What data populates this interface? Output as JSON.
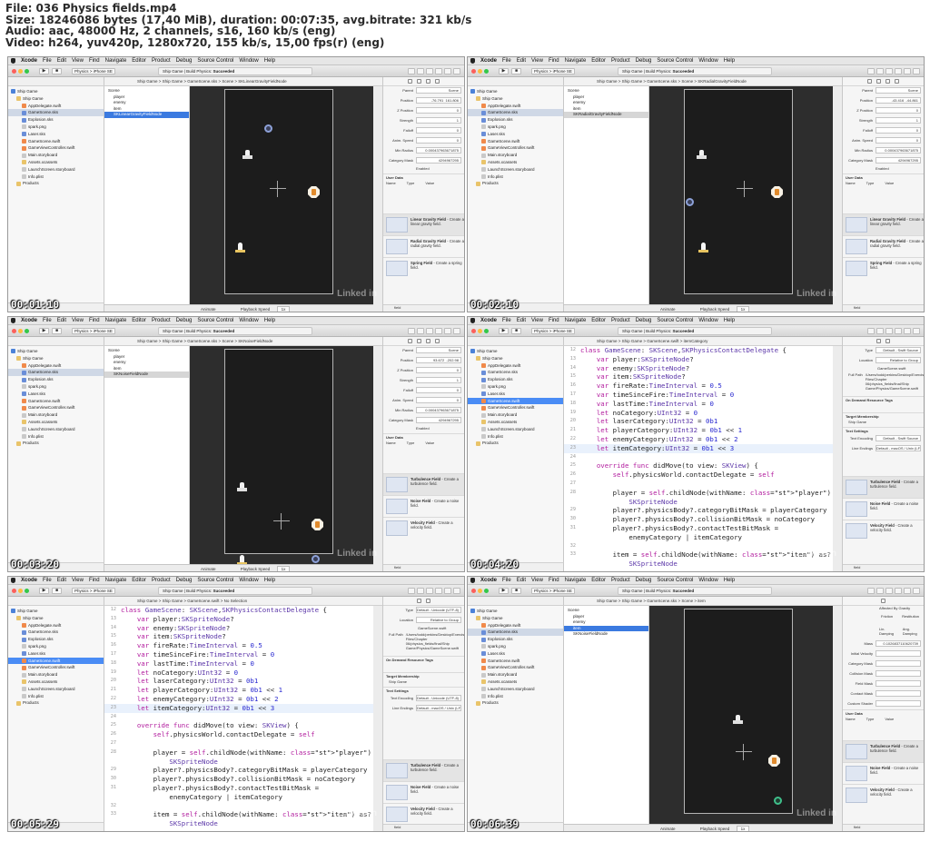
{
  "header": {
    "line1": "File: 036 Physics fields.mp4",
    "line2": "Size: 18246086 bytes (17,40 MiB), duration: 00:07:35, avg.bitrate: 321 kb/s",
    "line3": "Audio: aac, 48000 Hz, 2 channels, s16, 160 kb/s (eng)",
    "line4": "Video: h264, yuv420p, 1280x720, 155 kb/s, 15,00 fps(r) (eng)"
  },
  "menu": [
    "Xcode",
    "File",
    "Edit",
    "View",
    "Find",
    "Navigate",
    "Editor",
    "Product",
    "Debug",
    "Source Control",
    "Window",
    "Help"
  ],
  "toolbar": {
    "scheme": "Physics  >  iPhone SE",
    "activity_prefix": "Ship Game | Build Physics: ",
    "activity_status": "Succeeded"
  },
  "navigator": {
    "items": [
      {
        "label": "Ship Game",
        "icon": "project-icon",
        "indent": 0
      },
      {
        "label": "Ship Game",
        "icon": "folder-icon",
        "indent": 1
      },
      {
        "label": "AppDelegate.swift",
        "icon": "swift-file-icon",
        "indent": 2
      },
      {
        "label": "GameScene.sks",
        "icon": "sks-file-icon",
        "indent": 2
      },
      {
        "label": "Explosion.sks",
        "icon": "sks-file-icon",
        "indent": 2
      },
      {
        "label": "spark.png",
        "icon": "image-file-icon",
        "indent": 2
      },
      {
        "label": "Laser.sks",
        "icon": "sks-file-icon",
        "indent": 2
      },
      {
        "label": "GameScene.swift",
        "icon": "swift-file-icon",
        "indent": 2
      },
      {
        "label": "GameViewController.swift",
        "icon": "swift-file-icon",
        "indent": 2
      },
      {
        "label": "Main.storyboard",
        "icon": "storyboard-file-icon",
        "indent": 2
      },
      {
        "label": "Assets.xcassets",
        "icon": "folder-icon",
        "indent": 2
      },
      {
        "label": "LaunchScreen.storyboard",
        "icon": "storyboard-file-icon",
        "indent": 2
      },
      {
        "label": "Info.plist",
        "icon": "plist-file-icon",
        "indent": 2
      },
      {
        "label": "Products",
        "icon": "folder-icon",
        "indent": 1
      }
    ],
    "filter_placeholder": "Filter"
  },
  "outline_base": [
    "Scene",
    "player",
    "enemy",
    "item"
  ],
  "editor_bottom": {
    "animate": "Animate",
    "playback": "Playback Speed",
    "speed": "1x"
  },
  "inspector": {
    "props": [
      {
        "label": "Parent",
        "value": "Scene"
      },
      {
        "label": "Position",
        "value": ""
      },
      {
        "label": "Z Position",
        "value": "0"
      },
      {
        "label": "Strength",
        "value": "1"
      },
      {
        "label": "Falloff",
        "value": "0"
      },
      {
        "label": "Anim. Speed",
        "value": "0"
      },
      {
        "label": "Min Radius",
        "value": "0.000437963671875"
      },
      {
        "label": "Category Mask",
        "value": "4294967295"
      }
    ],
    "enabled": "Enabled",
    "user_data": "User Data",
    "name_col": "Name",
    "type_col": "Type",
    "value_col": "Value"
  },
  "library": {
    "linear": {
      "title": "Linear Gravity Field",
      "desc": "- Create a linear gravity field."
    },
    "radial": {
      "title": "Radial Gravity Field",
      "desc": "- Create a radial gravity field."
    },
    "spring": {
      "title": "Spring Field",
      "desc": "- Create a spring field."
    },
    "turbulence": {
      "title": "Turbulence Field",
      "desc": "- Create a turbulence field."
    },
    "noise": {
      "title": "Noise Field",
      "desc": "- Create a noise field."
    },
    "velocity": {
      "title": "Velocity Field",
      "desc": "- Create a velocity field."
    },
    "filter": "field"
  },
  "code_lines": [
    {
      "n": "12",
      "t": "class GameScene: SKScene,SKPhysicsContactDelegate {"
    },
    {
      "n": "13",
      "t": "    var player:SKSpriteNode?"
    },
    {
      "n": "14",
      "t": "    var enemy:SKSpriteNode?"
    },
    {
      "n": "15",
      "t": "    var item:SKSpriteNode?"
    },
    {
      "n": "16",
      "t": "    var fireRate:TimeInterval = 0.5"
    },
    {
      "n": "17",
      "t": "    var timeSinceFire:TimeInterval = 0"
    },
    {
      "n": "18",
      "t": "    var lastTime:TimeInterval = 0"
    },
    {
      "n": "19",
      "t": "    let noCategory:UInt32 = 0"
    },
    {
      "n": "20",
      "t": "    let laserCategory:UInt32 = 0b1"
    },
    {
      "n": "21",
      "t": "    let playerCategory:UInt32 = 0b1 << 1"
    },
    {
      "n": "22",
      "t": "    let enemyCategory:UInt32 = 0b1 << 2"
    },
    {
      "n": "23",
      "t": "    let itemCategory:UInt32 = 0b1 << 3"
    },
    {
      "n": "24",
      "t": ""
    },
    {
      "n": "25",
      "t": "    override func didMove(to view: SKView) {"
    },
    {
      "n": "26",
      "t": "        self.physicsWorld.contactDelegate = self"
    },
    {
      "n": "27",
      "t": ""
    },
    {
      "n": "28",
      "t": "        player = self.childNode(withName: \"player\") as?"
    },
    {
      "n": "",
      "t": "            SKSpriteNode"
    },
    {
      "n": "29",
      "t": "        player?.physicsBody?.categoryBitMask = playerCategory"
    },
    {
      "n": "30",
      "t": "        player?.physicsBody?.collisionBitMask = noCategory"
    },
    {
      "n": "31",
      "t": "        player?.physicsBody?.contactTestBitMask ="
    },
    {
      "n": "",
      "t": "            enemyCategory | itemCategory"
    },
    {
      "n": "32",
      "t": ""
    },
    {
      "n": "33",
      "t": "        item = self.childNode(withName: \"item\") as?"
    },
    {
      "n": "",
      "t": "            SKSpriteNode"
    }
  ],
  "frames": [
    {
      "timestamp": "00:01:10",
      "jump": "Ship Game  >  Ship Game  >  GameScene.sks  >  Scene  >  SKLinearGravityFieldNode",
      "outline_extra": "SKLinearGravityFieldNode",
      "position_x": "-76.791",
      "position_y": "161.806"
    },
    {
      "timestamp": "00:02:10",
      "jump": "Ship Game  >  Ship Game  >  GameScene.sks  >  Scene  >  SKRadialGravityFieldNode",
      "outline_extra": "SKRadialGravityFieldNode",
      "position_x": "-43.416",
      "position_y": "-44.861"
    },
    {
      "timestamp": "00:03:20",
      "jump": "Ship Game  >  Ship Game  >  GameScene.sks  >  Scene  >  SKNoiseFieldNode",
      "outline_extra": "SKNoiseFieldNode",
      "position_x": "93.672",
      "position_y": "-202.98"
    },
    {
      "timestamp": "00:04:20",
      "jump": "Ship Game  >  Ship Game  >  GameScene.swift  >  itemCategory",
      "inspector_type": "Default - Swift Source"
    },
    {
      "timestamp": "00:05:29",
      "jump": "Ship Game  >  Ship Game  >  GameScene.swift  >  No Selection",
      "inspector_type": "Default - Unicode (UTF-8)"
    },
    {
      "timestamp": "00:06:39",
      "jump": "Ship Game  >  Ship Game  >  GameScene.sks  >  Scene  >  item",
      "outline_extra": "SKNoiseFieldNode"
    }
  ],
  "file_inspector": {
    "type_label": "Type",
    "location_label": "Location",
    "location_value": "Relative to Group",
    "filename": "GameScene.swift",
    "fullpath_label": "Full Path",
    "fullpath_value": "/Users/todd/perkins/Desktop/Exercise Files/Chapter 06/physics_fields/final/Ship Game/Physics/GameScene.swift",
    "on_demand": "On Demand Resource Tags",
    "membership": "Target Membership",
    "target": "Ship Game",
    "text_settings": "Text Settings",
    "encoding_label": "Text Encoding",
    "line_endings_label": "Line Endings",
    "line_endings_value": "Default - macOS / Unix (LF)"
  },
  "item_inspector": {
    "affected": "Affected By Gravity",
    "friction": "Friction",
    "restitution": "Restitution",
    "lin_damp": "Lin. Damping",
    "ang_damp": "Ang. Damping",
    "mass": "Mass",
    "mass_value": "0.1026837110620739",
    "initial_velocity": "Initial Velocity",
    "category_mask": "Category Mask",
    "collision_mask": "Collision Mask",
    "field_mask": "Field Mask",
    "contact_mask": "Contact Mask",
    "custom_shader": "Custom Shader"
  },
  "watermark": "Linked in"
}
